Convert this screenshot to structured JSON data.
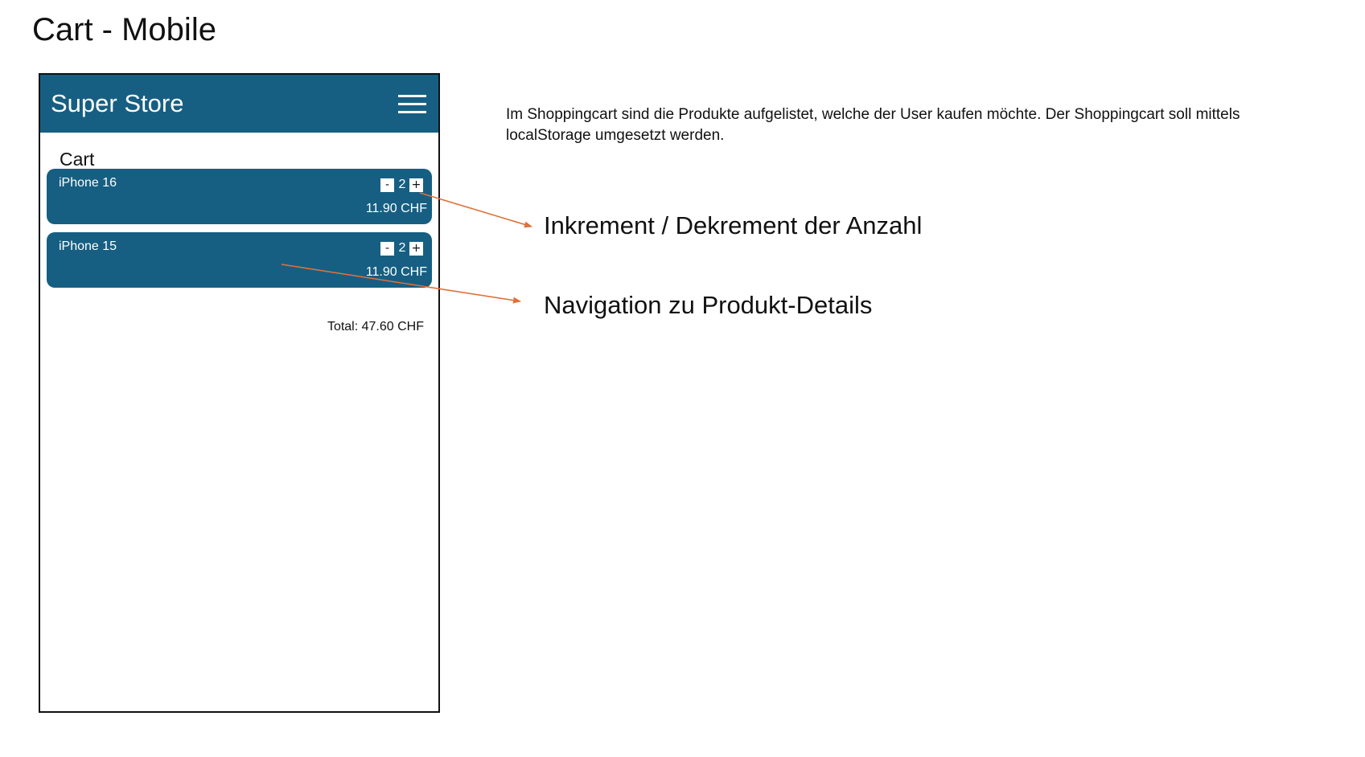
{
  "page": {
    "title": "Cart - Mobile"
  },
  "app": {
    "title": "Super Store",
    "menu_icon": "hamburger-icon"
  },
  "cart": {
    "heading": "Cart",
    "items": [
      {
        "name": "iPhone 16",
        "decrement_label": "-",
        "quantity": "2",
        "increment_label": "+",
        "price": "11.90 CHF"
      },
      {
        "name": "iPhone 15",
        "decrement_label": "-",
        "quantity": "2",
        "increment_label": "+",
        "price": "11.90 CHF"
      }
    ],
    "total": "Total: 47.60 CHF"
  },
  "annotations": {
    "description": "Im Shoppingcart sind die Produkte aufgelistet, welche der User kaufen möchte. Der Shoppingcart soll mittels localStorage umgesetzt werden.",
    "callout_quantity": "Inkrement / Dekrement der Anzahl",
    "callout_navigation": "Navigation zu Produkt-Details"
  },
  "colors": {
    "primary": "#165f82",
    "arrow": "#e0703a",
    "text": "#111111",
    "background": "#ffffff"
  }
}
